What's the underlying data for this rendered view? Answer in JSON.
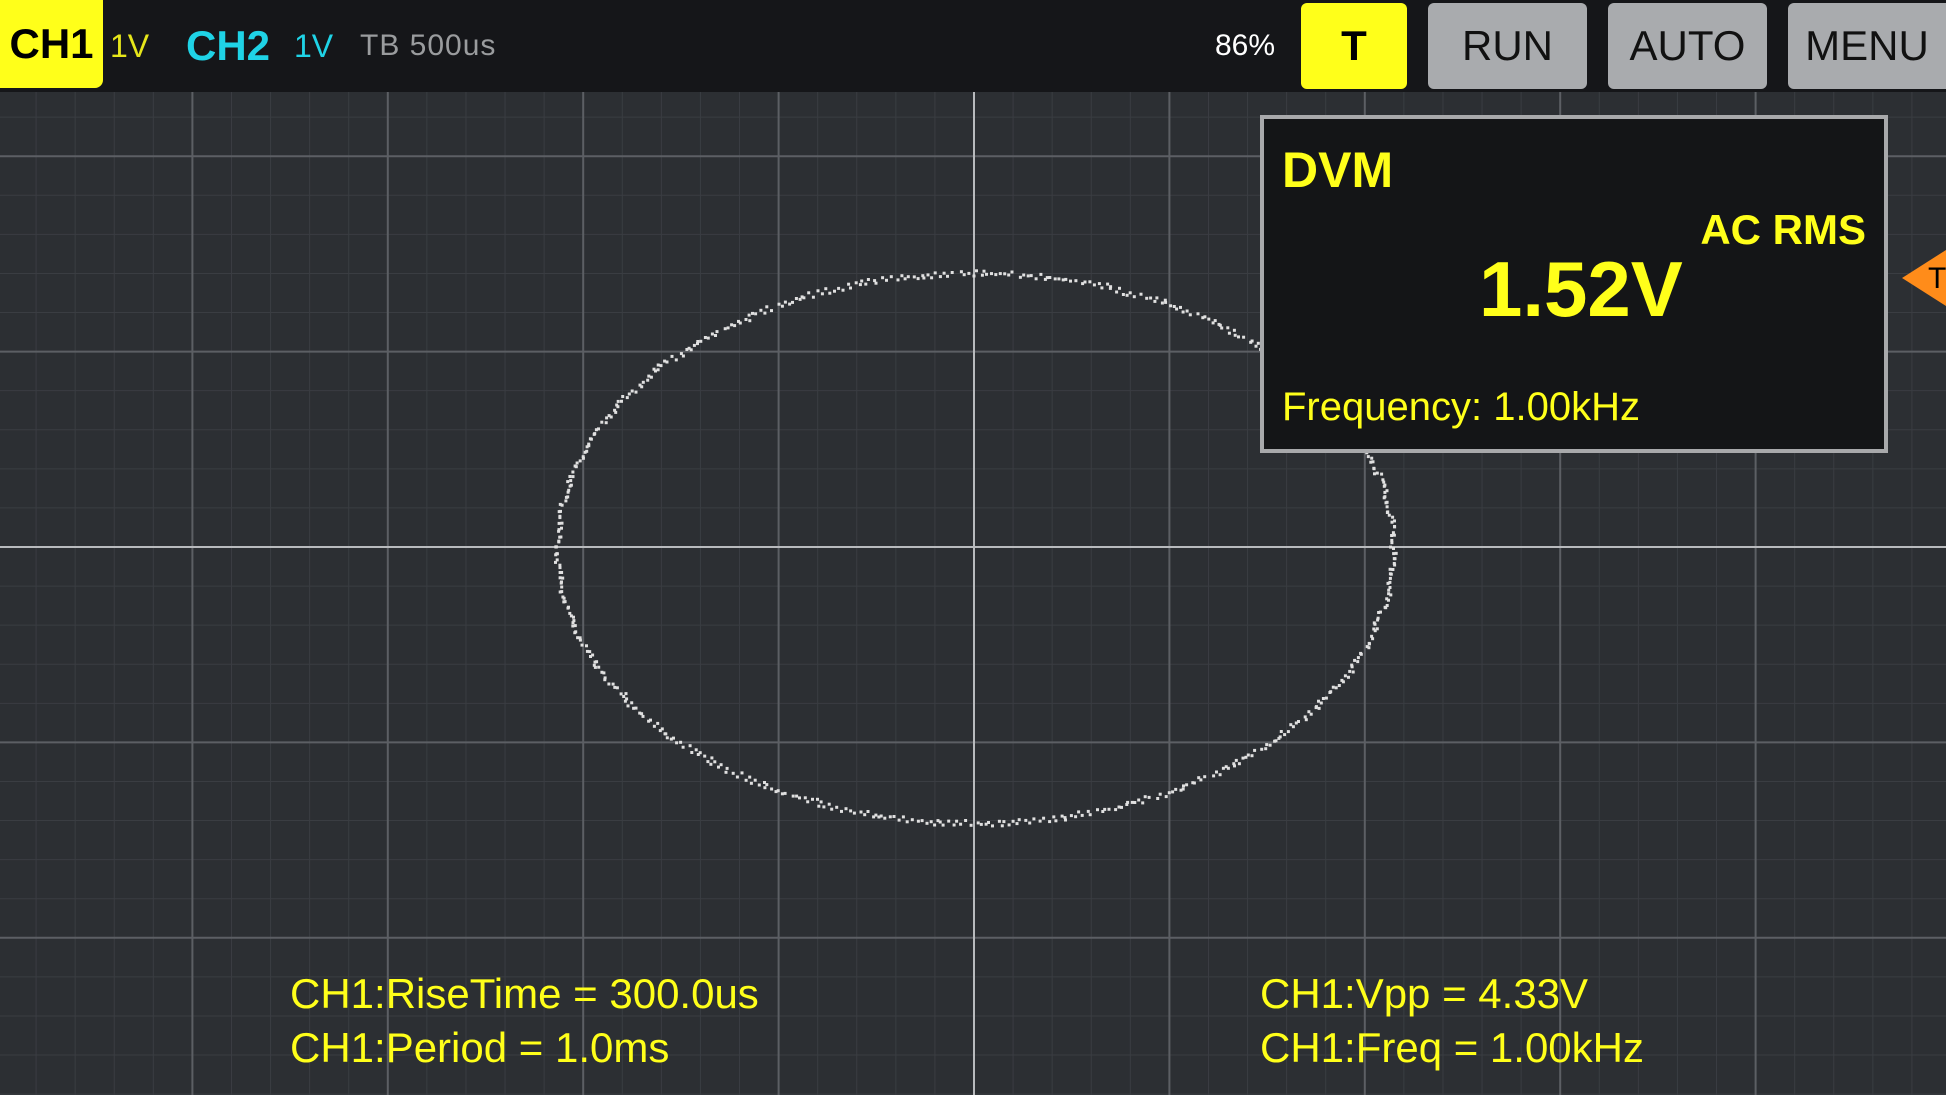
{
  "topbar": {
    "ch1_label": "CH1",
    "ch1_scale": "1V",
    "ch2_label": "CH2",
    "ch2_scale": "1V",
    "timebase": "TB 500us",
    "battery": "86%",
    "trigger_label": "T",
    "run_label": "RUN",
    "auto_label": "AUTO",
    "menu_label": "MENU"
  },
  "dvm": {
    "title": "DVM",
    "mode": "AC RMS",
    "value": "1.52V",
    "frequency": "Frequency: 1.00kHz"
  },
  "trigger_marker": {
    "label": "T",
    "icon": "trigger-level-marker-icon",
    "color": "#ff8c1a"
  },
  "measurements": {
    "rise_time": "CH1:RiseTime = 300.0us",
    "period": "CH1:Period = 1.0ms",
    "vpp": "CH1:Vpp = 4.33V",
    "freq": "CH1:Freq = 1.00kHz"
  },
  "colors": {
    "ch1": "#ffff1a",
    "ch2": "#1fd3e6",
    "trace": "#e0e0e0",
    "background": "#2c2f33"
  }
}
